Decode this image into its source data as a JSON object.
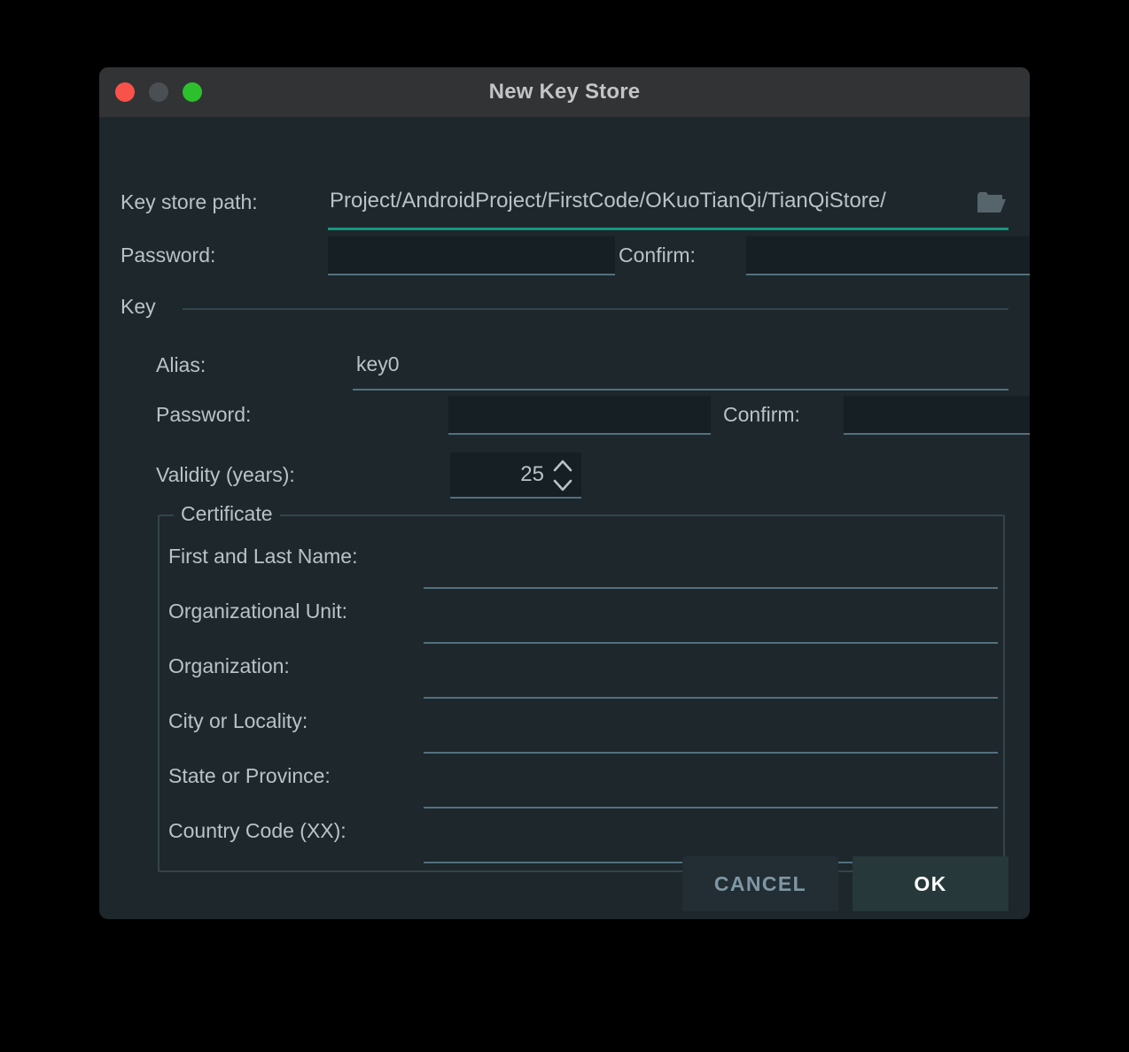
{
  "window": {
    "title": "New Key Store",
    "controls": {
      "close": "close-button",
      "minimize": "minimize-button",
      "zoom": "zoom-button"
    }
  },
  "colors": {
    "window_body": "#1d272c",
    "titlebar": "#313335",
    "focus_underline": "#13987f",
    "field_underline": "#53707f",
    "field_fill": "#161f24",
    "label_text": "#b9c3c7",
    "ok_text": "#ffffff",
    "cancel_text": "#7f97a4",
    "traffic_close": "#f9524a",
    "traffic_min": "#4a4f53",
    "traffic_zoom": "#2cc02c"
  },
  "key_store": {
    "path_label": "Key store path:",
    "path_value": "/Project/AndroidProject/FirstCode/OKuoTianQi/TianQiStore",
    "path_placeholder": "",
    "browse_icon": "folder-icon",
    "password_label": "Password:",
    "password_value": "",
    "confirm_label": "Confirm:",
    "confirm_value": ""
  },
  "key_section": {
    "title": "Key",
    "alias_label": "Alias:",
    "alias_value": "key0",
    "password_label": "Password:",
    "password_value": "",
    "confirm_label": "Confirm:",
    "confirm_value": "",
    "validity_label": "Validity (years):",
    "validity_value": "25",
    "spinner_up_icon": "chevron-up-icon",
    "spinner_down_icon": "chevron-down-icon"
  },
  "certificate": {
    "title": "Certificate",
    "fields": [
      {
        "label": "First and Last Name:",
        "value": ""
      },
      {
        "label": "Organizational Unit:",
        "value": ""
      },
      {
        "label": "Organization:",
        "value": ""
      },
      {
        "label": "City or Locality:",
        "value": ""
      },
      {
        "label": "State or Province:",
        "value": ""
      },
      {
        "label": "Country Code (XX):",
        "value": ""
      }
    ]
  },
  "footer": {
    "cancel_label": "CANCEL",
    "ok_label": "OK"
  }
}
